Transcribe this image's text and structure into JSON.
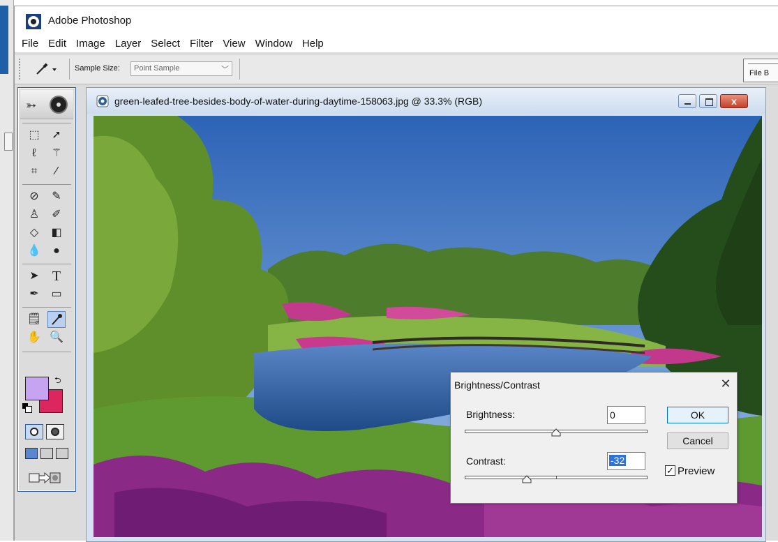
{
  "app": {
    "title": "Adobe Photoshop"
  },
  "menu": [
    "File",
    "Edit",
    "Image",
    "Layer",
    "Select",
    "Filter",
    "View",
    "Window",
    "Help"
  ],
  "options_bar": {
    "sample_size_label": "Sample Size:",
    "sample_size_value": "Point Sample",
    "file_browser_label": "File B"
  },
  "toolbox": {
    "foreground_color": "#c6a4f2",
    "background_color": "#dc2660",
    "icons": [
      "marquee-icon",
      "move-icon",
      "lasso-icon",
      "magic-wand-icon",
      "crop-icon",
      "slice-icon",
      "healing-brush-icon",
      "brush-icon",
      "clone-stamp-icon",
      "history-brush-icon",
      "eraser-icon",
      "gradient-icon",
      "blur-icon",
      "dodge-icon",
      "path-selection-icon",
      "type-icon",
      "pen-icon",
      "shape-icon",
      "notes-icon",
      "eyedropper-icon",
      "hand-icon",
      "zoom-icon"
    ],
    "type_tool_glyph": "T"
  },
  "document": {
    "title": "green-leafed-tree-besides-body-of-water-during-daytime-158063.jpg @ 33.3% (RGB)",
    "close_glyph": "x"
  },
  "dialog": {
    "title": "Brightness/Contrast",
    "close_glyph": "✕",
    "brightness_label": "Brightness:",
    "brightness_value": "0",
    "brightness_level": 0,
    "contrast_label": "Contrast:",
    "contrast_value": "-32",
    "contrast_level": -32,
    "ok_label": "OK",
    "cancel_label": "Cancel",
    "preview_label": "Preview",
    "preview_checked": true,
    "check_glyph": "✓"
  }
}
